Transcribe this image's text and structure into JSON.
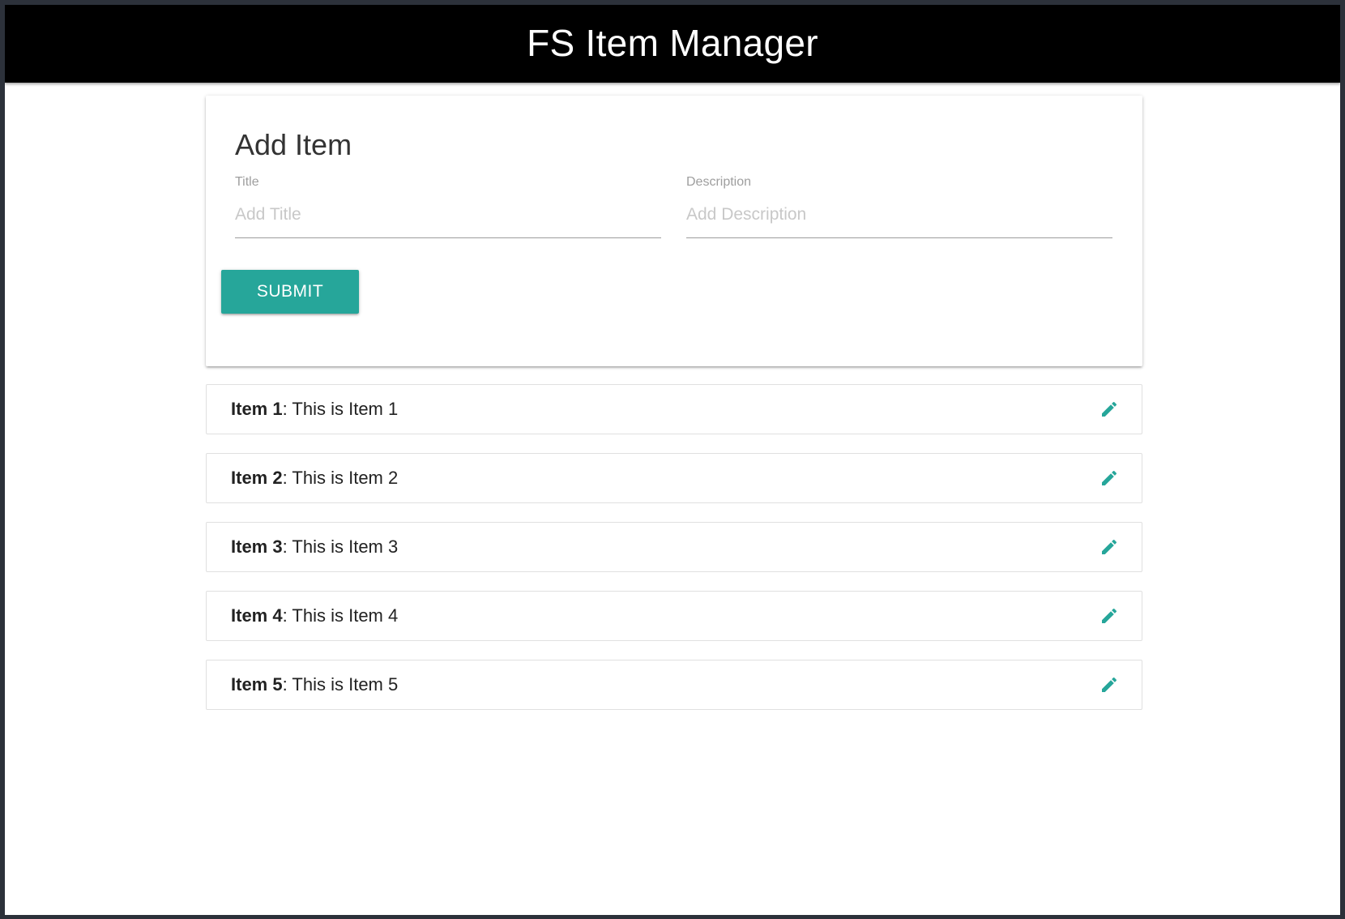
{
  "navbar": {
    "title": "FS Item Manager",
    "color": "#000000"
  },
  "form": {
    "heading": "Add Item",
    "title_field": {
      "label": "Title",
      "placeholder": "Add Title",
      "value": ""
    },
    "description_field": {
      "label": "Description",
      "placeholder": "Add Description",
      "value": ""
    },
    "submit_label": "SUBMIT",
    "accent_color": "#26a69a"
  },
  "items": [
    {
      "title": "Item 1",
      "separator": ": ",
      "description": "This is Item 1",
      "icon": "pencil-icon"
    },
    {
      "title": "Item 2",
      "separator": ": ",
      "description": "This is Item 2",
      "icon": "pencil-icon"
    },
    {
      "title": "Item 3",
      "separator": ": ",
      "description": "This is Item 3",
      "icon": "pencil-icon"
    },
    {
      "title": "Item 4",
      "separator": ": ",
      "description": "This is Item 4",
      "icon": "pencil-icon"
    },
    {
      "title": "Item 5",
      "separator": ": ",
      "description": "This is Item 5",
      "icon": "pencil-icon"
    }
  ]
}
